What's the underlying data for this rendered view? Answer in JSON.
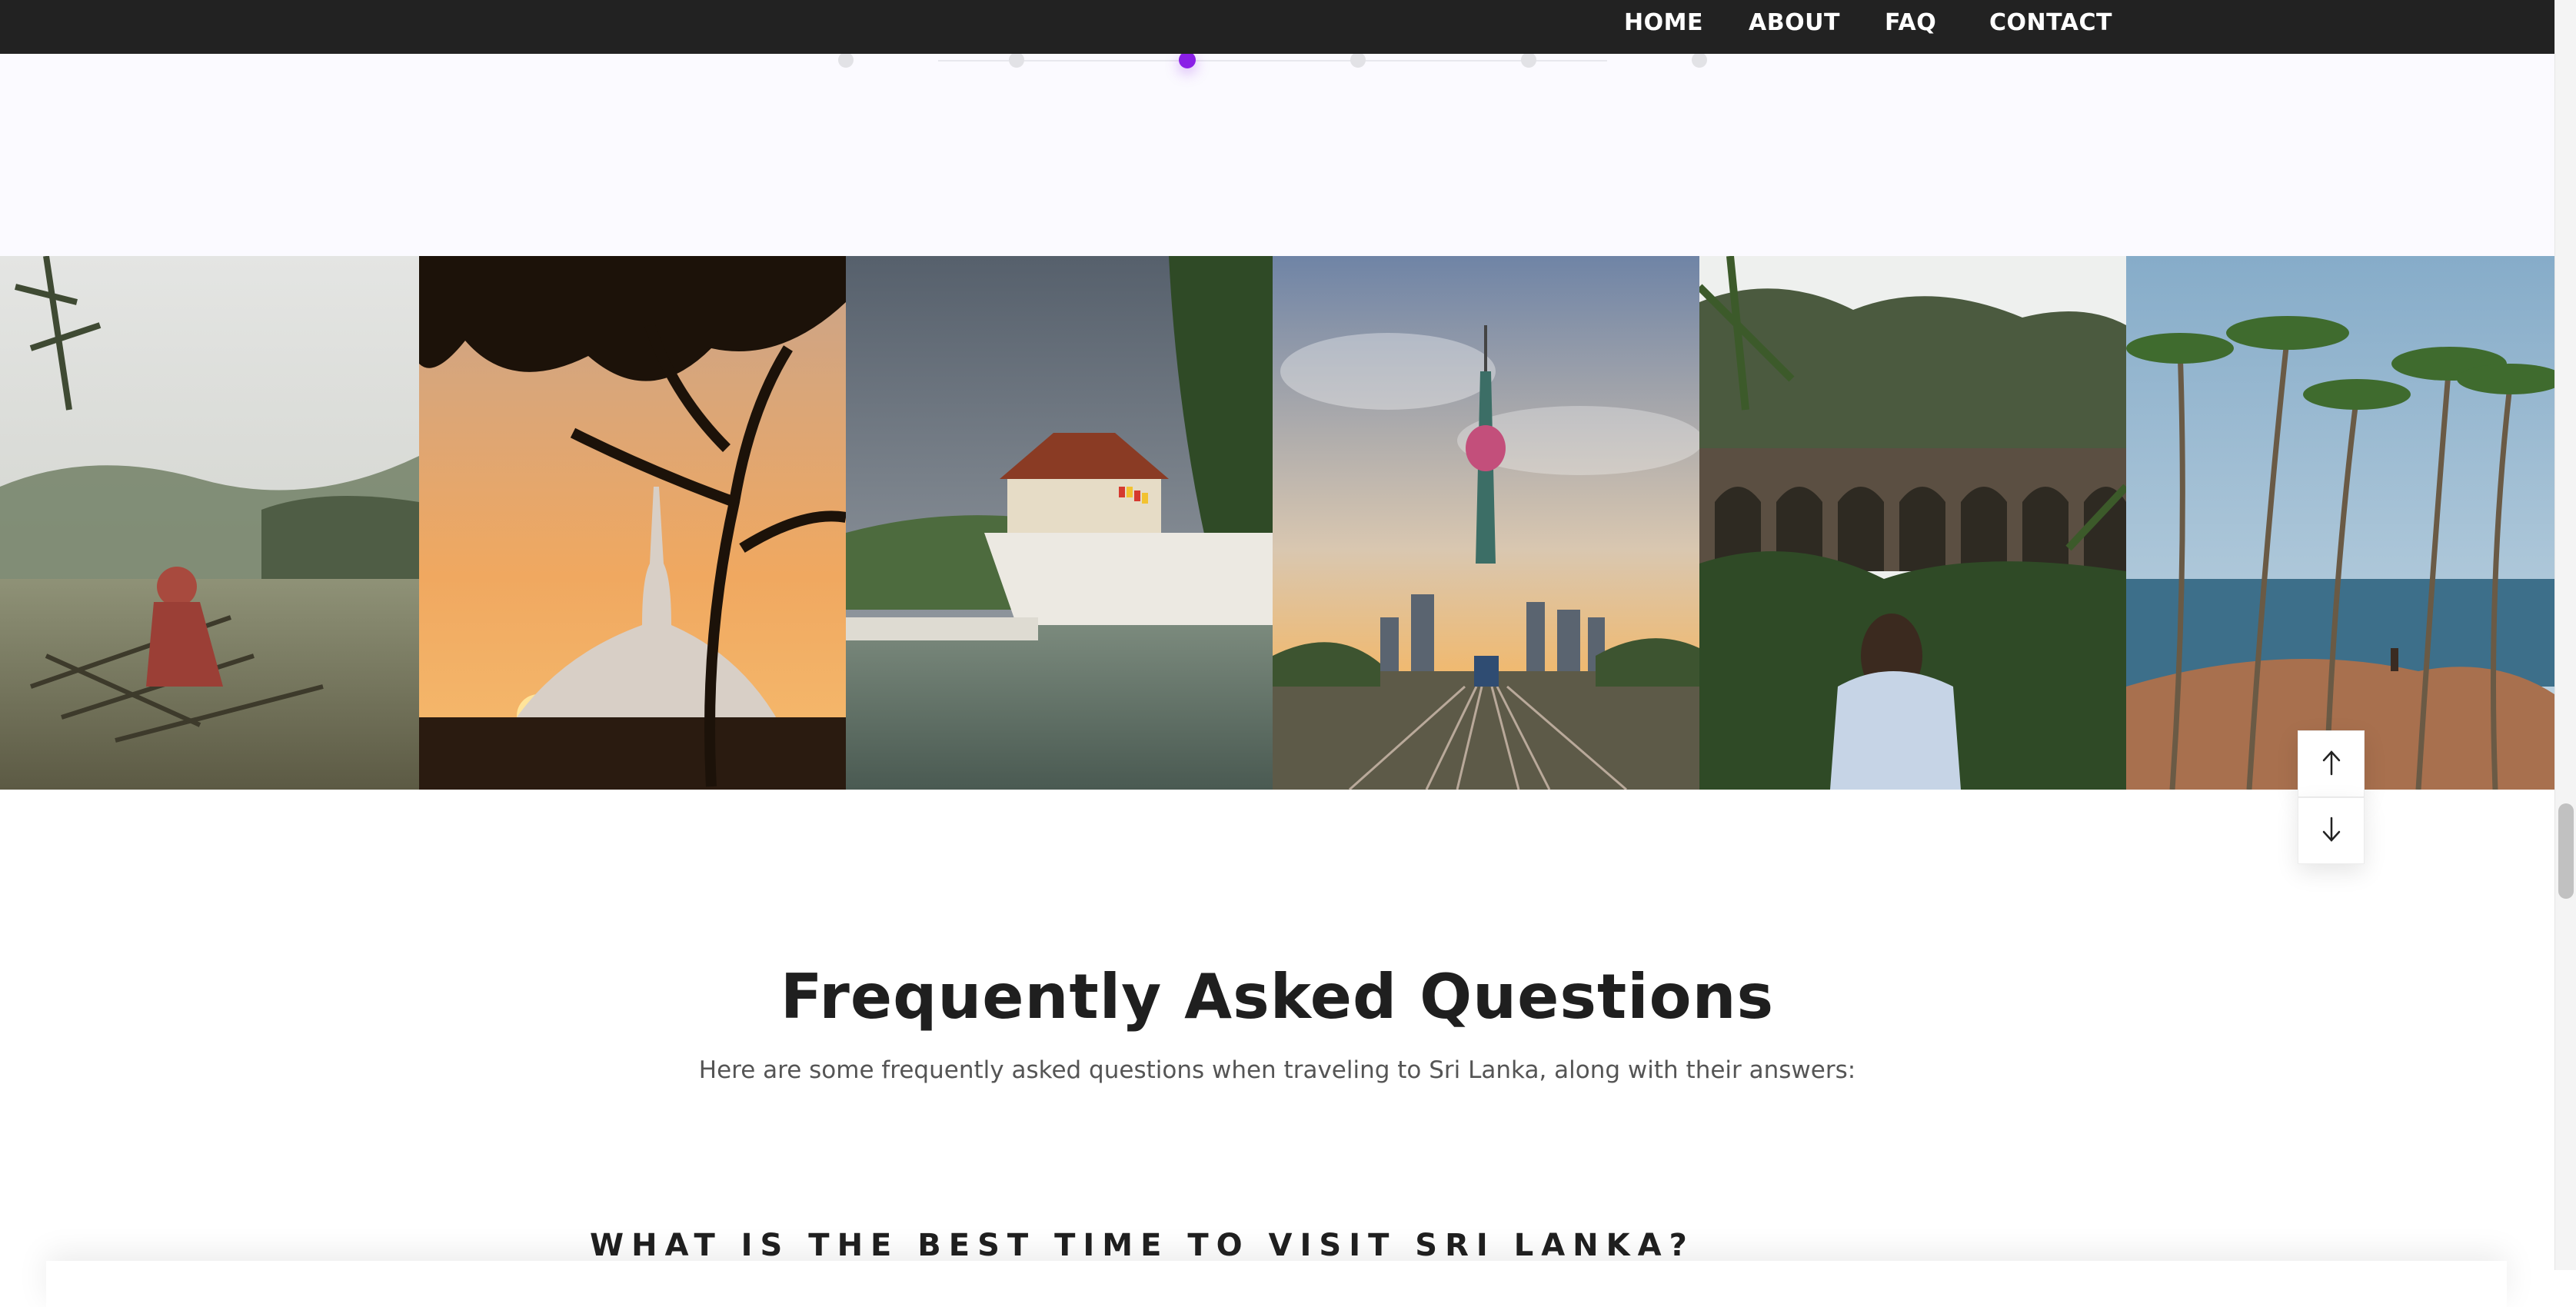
{
  "nav": {
    "items": [
      {
        "label": "HOME"
      },
      {
        "label": "ABOUT"
      },
      {
        "label": "FAQ"
      },
      {
        "label": "CONTACT"
      }
    ]
  },
  "timeline": {
    "dots": 6,
    "active_index": 2,
    "accent_color": "#8a1fe6"
  },
  "gallery": {
    "photos": [
      {
        "icon": "farmer-field-photo"
      },
      {
        "icon": "stupa-sunset-photo"
      },
      {
        "icon": "temple-of-tooth-photo"
      },
      {
        "icon": "lotus-tower-photo"
      },
      {
        "icon": "nine-arch-bridge-photo"
      },
      {
        "icon": "palm-beach-photo"
      }
    ]
  },
  "scroll_controls": {
    "up_icon": "arrow-up-icon",
    "down_icon": "arrow-down-icon"
  },
  "faq": {
    "title": "Frequently Asked Questions",
    "subtitle": "Here are some frequently asked questions when traveling to Sri Lanka, along with their answers:",
    "questions": [
      {
        "question": "WHAT IS THE BEST TIME TO VISIT SRI LANKA?"
      }
    ]
  },
  "colors": {
    "nav_bg": "#222222",
    "upper_band_bg": "#fbfaff",
    "text_dark": "#1f1f1f"
  }
}
